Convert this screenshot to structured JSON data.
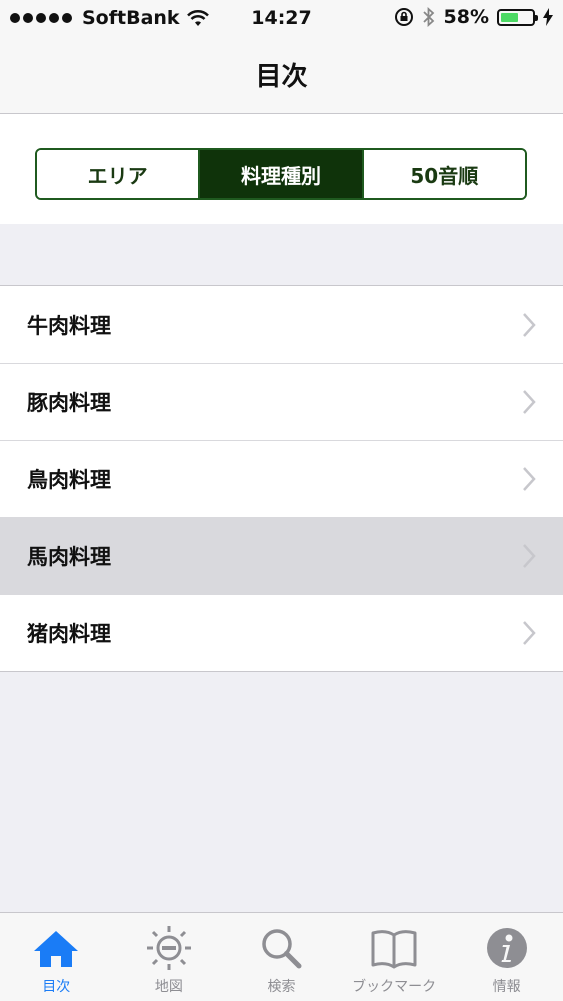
{
  "status_bar": {
    "carrier": "SoftBank",
    "time": "14:27",
    "battery_percent": "58%",
    "battery_level": 0.58,
    "icons": [
      "signal-dots-icon",
      "wifi-icon",
      "orientation-lock-icon",
      "bluetooth-icon",
      "battery-icon",
      "charging-icon"
    ]
  },
  "nav": {
    "title": "目次"
  },
  "segments": {
    "items": [
      {
        "label": "エリア"
      },
      {
        "label": "料理種別"
      },
      {
        "label": "50音順"
      }
    ],
    "selected_index": 1
  },
  "list": {
    "items": [
      {
        "label": "牛肉料理"
      },
      {
        "label": "豚肉料理"
      },
      {
        "label": "鳥肉料理"
      },
      {
        "label": "馬肉料理"
      },
      {
        "label": "猪肉料理"
      }
    ],
    "highlighted_index": 3
  },
  "tabbar": {
    "items": [
      {
        "label": "目次",
        "icon": "home-icon"
      },
      {
        "label": "地図",
        "icon": "map-icon"
      },
      {
        "label": "検索",
        "icon": "search-icon"
      },
      {
        "label": "ブックマーク",
        "icon": "bookmark-book-icon"
      },
      {
        "label": "情報",
        "icon": "info-icon"
      }
    ],
    "active_index": 0
  },
  "colors": {
    "segment_active_bg": "#0f330a",
    "segment_border": "#1f5a1f",
    "tab_active": "#1a7cf6",
    "tab_inactive": "#8e8e93",
    "battery_fill": "#4cd964"
  }
}
